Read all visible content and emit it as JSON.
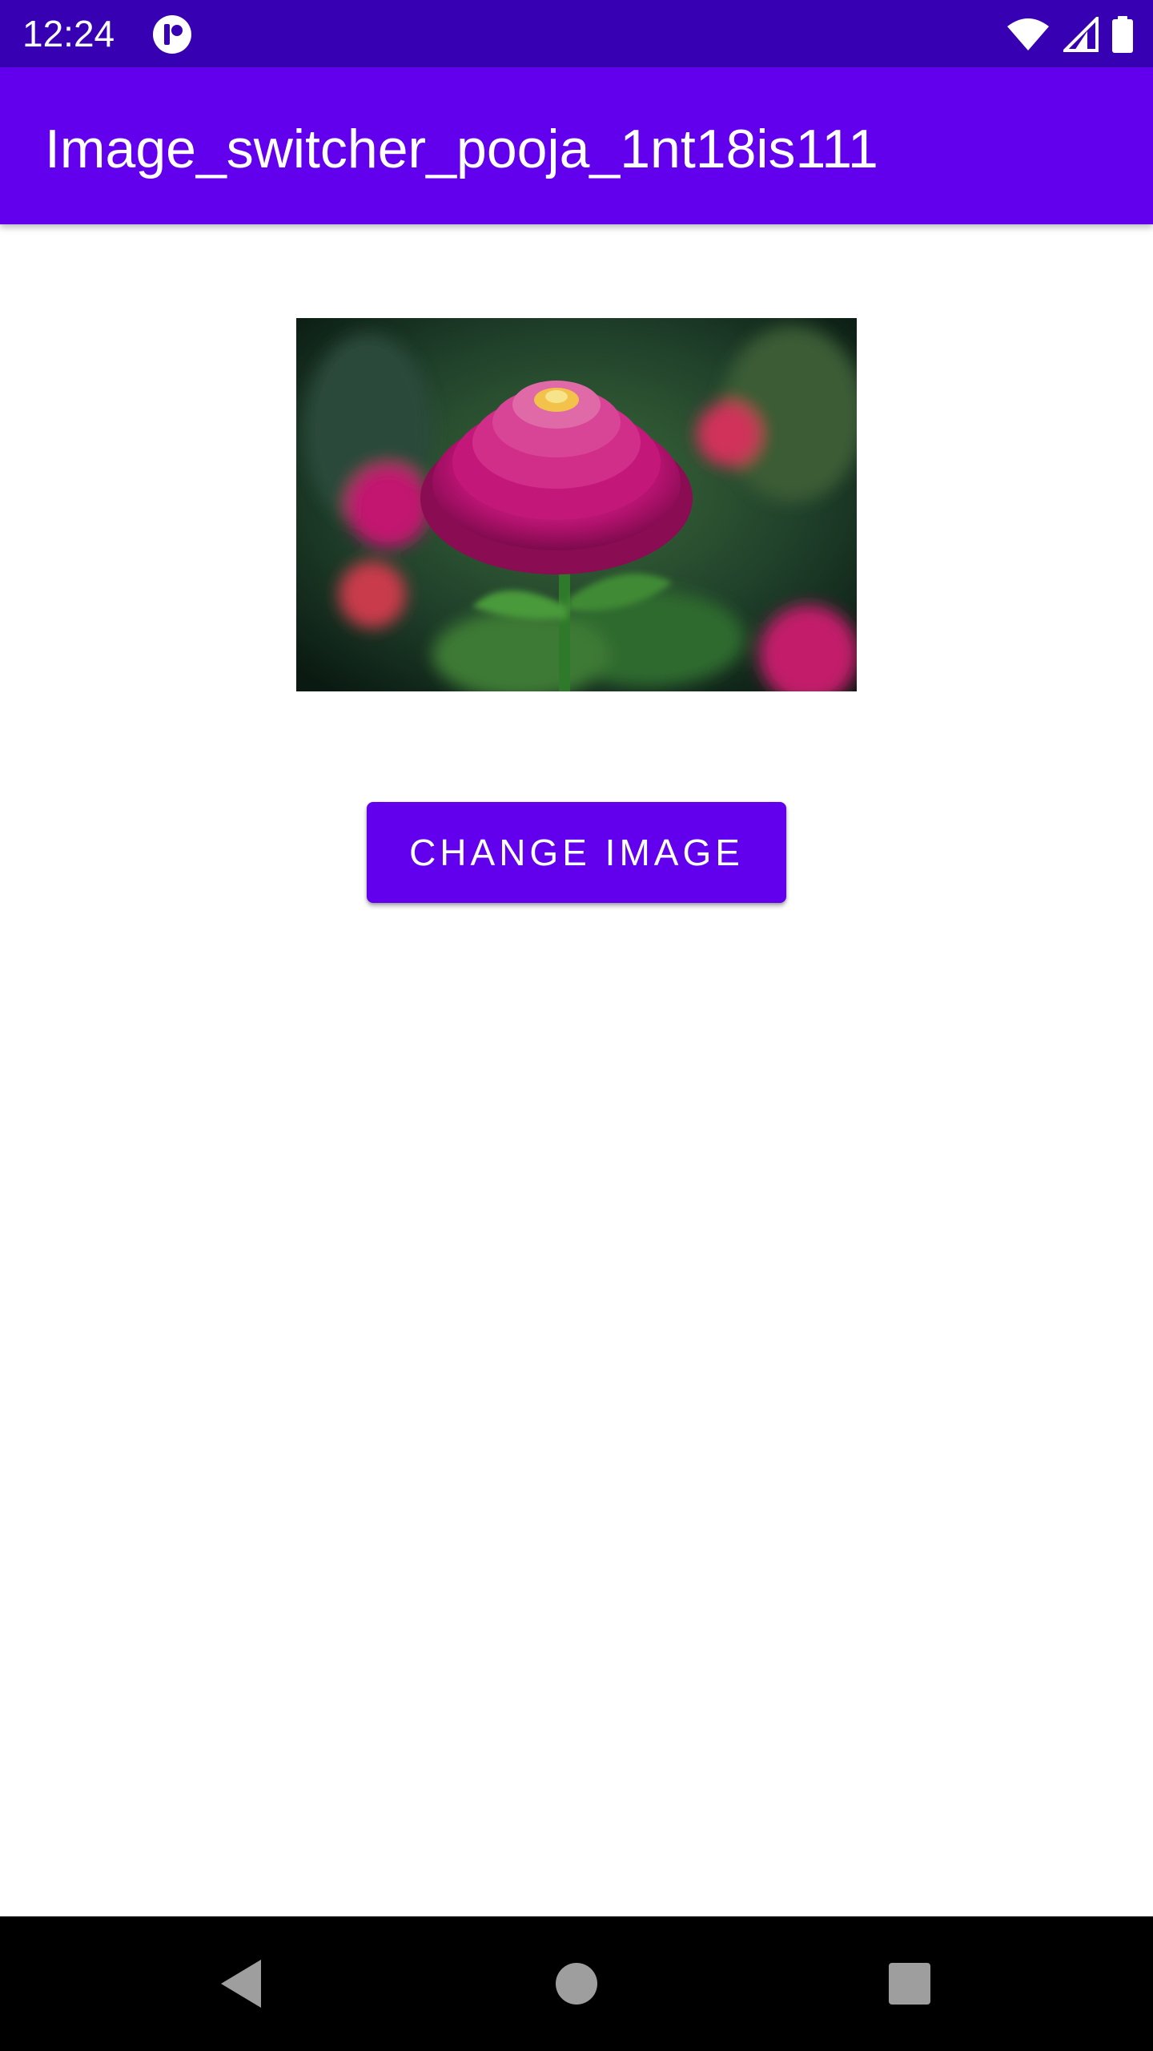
{
  "status_bar": {
    "time": "12:24",
    "icons": [
      "app-notification-icon",
      "wifi-icon",
      "cellular-signal-icon",
      "battery-icon"
    ],
    "color": "#3700b3"
  },
  "app_bar": {
    "title": "Image_switcher_pooja_1nt18is111",
    "color": "#6200ee"
  },
  "main": {
    "image": {
      "subject": "pink zinnia flower"
    },
    "change_button_label": "CHANGE IMAGE"
  },
  "nav_bar": {
    "icons": [
      "back-icon",
      "home-icon",
      "recents-icon"
    ]
  }
}
